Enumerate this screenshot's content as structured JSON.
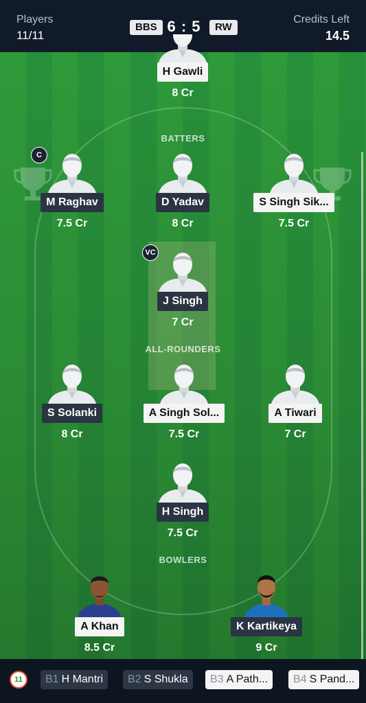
{
  "header": {
    "players_label": "Players",
    "players_value": "11/11",
    "team_a": "BBS",
    "score": "6 : 5",
    "team_b": "RW",
    "credits_label": "Credits Left",
    "credits_value": "14.5"
  },
  "roles": {
    "batters": "BATTERS",
    "all_rounders": "ALL-ROUNDERS",
    "bowlers": "BOWLERS"
  },
  "players": {
    "h_gawli": {
      "name": "H Gawli",
      "credits": "8 Cr"
    },
    "m_raghav": {
      "name": "M Raghav",
      "credits": "7.5 Cr",
      "tag": "C"
    },
    "d_yadav": {
      "name": "D Yadav",
      "credits": "8 Cr"
    },
    "s_singh": {
      "name": "S Singh Sik...",
      "credits": "7.5 Cr"
    },
    "j_singh": {
      "name": "J Singh",
      "credits": "7 Cr",
      "tag": "VC"
    },
    "s_solanki": {
      "name": "S Solanki",
      "credits": "8 Cr"
    },
    "a_singh": {
      "name": "A Singh Sol...",
      "credits": "7.5 Cr"
    },
    "a_tiwari": {
      "name": "A Tiwari",
      "credits": "7 Cr"
    },
    "h_singh": {
      "name": "H Singh",
      "credits": "7.5 Cr"
    },
    "a_khan": {
      "name": "A Khan",
      "credits": "8.5 Cr"
    },
    "k_kartikeya": {
      "name": "K Kartikeya",
      "credits": "9 Cr"
    }
  },
  "bench": [
    {
      "tag": "B1",
      "name": "H Mantri"
    },
    {
      "tag": "B2",
      "name": "S Shukla"
    },
    {
      "tag": "B3",
      "name": "A Path..."
    },
    {
      "tag": "B4",
      "name": "S Pand..."
    }
  ],
  "colors": {
    "header_bg": "#101a28",
    "field_green": "#2f9a3a",
    "dark_label": "#2a3442",
    "light_label": "#f4f4f4"
  }
}
